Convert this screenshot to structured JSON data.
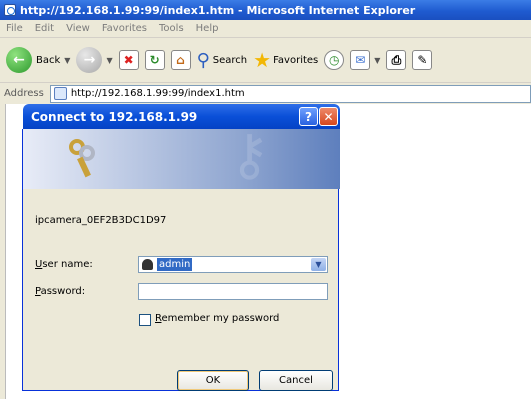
{
  "window": {
    "title": "http://192.168.1.99:99/index1.htm - Microsoft Internet Explorer"
  },
  "menu": [
    "File",
    "Edit",
    "View",
    "Favorites",
    "Tools",
    "Help"
  ],
  "toolbar": {
    "back": "Back",
    "search": "Search",
    "favorites": "Favorites"
  },
  "address": {
    "label": "Address",
    "url": "http://192.168.1.99:99/index1.htm"
  },
  "dialog": {
    "title": "Connect to 192.168.1.99",
    "help": "?",
    "close": "✕",
    "site": "ipcamera_0EF2B3DC1D97",
    "username_label": "User name:",
    "username_value": "admin",
    "password_label": "Password:",
    "remember_label": "Remember my password",
    "ok": "OK",
    "cancel": "Cancel"
  }
}
